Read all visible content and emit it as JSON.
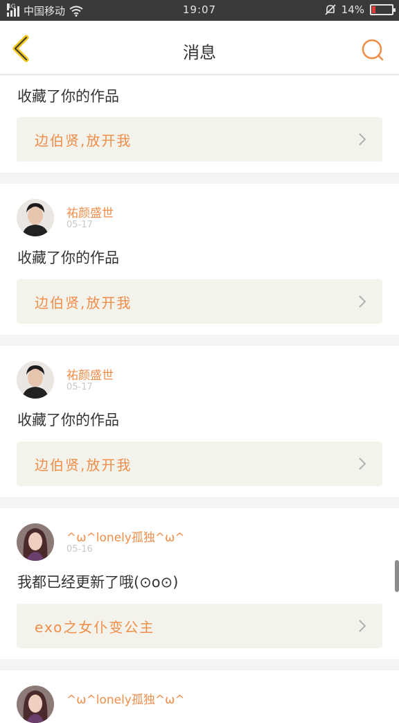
{
  "status_bar": {
    "network": "4G",
    "carrier": "中国移动",
    "time": "19:07",
    "battery": "14%"
  },
  "header": {
    "title": "消息",
    "back_icon": "chevron-left-icon",
    "search_icon": "search-icon"
  },
  "colors": {
    "accent": "#f08d49",
    "back": "#f5c518",
    "card_bg": "#f3f3ec"
  },
  "messages": [
    {
      "action": "收藏了你的作品",
      "work_title": "边伯贤,放开我"
    },
    {
      "user": "祐颜盛世",
      "date": "05-17",
      "action": "收藏了你的作品",
      "work_title": "边伯贤,放开我"
    },
    {
      "user": "祐颜盛世",
      "date": "05-17",
      "action": "收藏了你的作品",
      "work_title": "边伯贤,放开我"
    },
    {
      "user": "^ω^lonely孤独^ω^",
      "date": "05-16",
      "action": "我都已经更新了哦(⊙o⊙)",
      "work_title": "exo之女仆变公主"
    },
    {
      "user": "^ω^lonely孤独^ω^"
    }
  ]
}
